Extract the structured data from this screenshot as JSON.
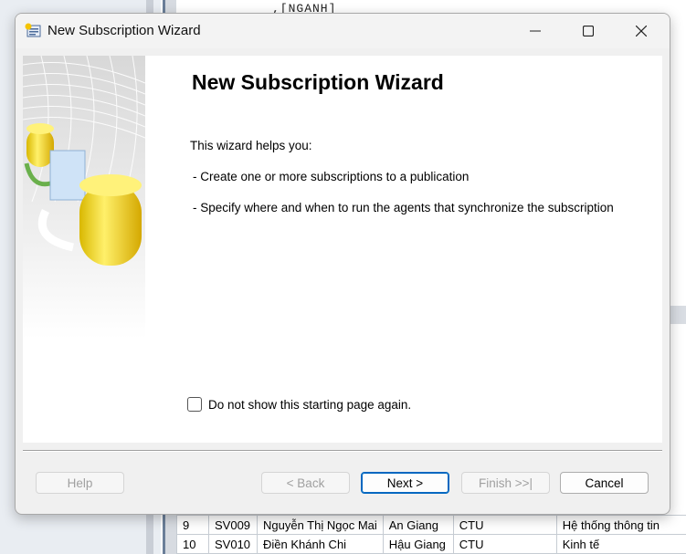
{
  "background": {
    "top_text": ",[NGANH]",
    "grid_rows": [
      {
        "id": "9",
        "code": "SV009",
        "name": "Nguyễn Thị Ngọc Mai",
        "province": "An Giang",
        "school": "CTU",
        "major": "Hệ thống thông tin"
      },
      {
        "id": "10",
        "code": "SV010",
        "name": "Điền Khánh Chi",
        "province": "Hậu Giang",
        "school": "CTU",
        "major": "Kinh tế"
      }
    ]
  },
  "dialog": {
    "title": "New Subscription Wizard",
    "heading": "New Subscription Wizard",
    "intro": "This wizard helps you:",
    "bullets": [
      " - Create one or more subscriptions to a publication",
      " - Specify where and when to run the agents that synchronize the subscription"
    ],
    "checkbox_label": "Do not show this starting page again.",
    "checkbox_checked": false,
    "buttons": {
      "help": "Help",
      "back": "< Back",
      "next": "Next >",
      "finish": "Finish >>|",
      "cancel": "Cancel"
    }
  },
  "icons": {
    "app": "wizard-app-icon",
    "minimize": "minimize-icon",
    "maximize": "maximize-icon",
    "close": "close-icon"
  },
  "colors": {
    "accent": "#0067c0",
    "disabled_text": "#a0a0a0",
    "dialog_bg": "#f0f0f0"
  }
}
